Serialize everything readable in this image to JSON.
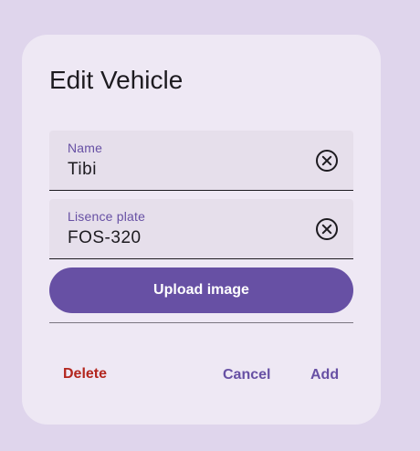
{
  "dialog": {
    "title": "Edit Vehicle",
    "fields": [
      {
        "label": "Name",
        "value": "Tibi"
      },
      {
        "label": "Lisence plate",
        "value": "FOS-320"
      }
    ],
    "upload_label": "Upload image",
    "actions": {
      "delete_label": "Delete",
      "cancel_label": "Cancel",
      "add_label": "Add"
    }
  },
  "colors": {
    "background": "#dfd5ec",
    "surface": "#eee8f4",
    "field_fill": "#e6dfeb",
    "primary": "#6750a4",
    "error": "#b3261e",
    "on_surface": "#1d1b20"
  },
  "icons": {
    "clear": "close-circle-icon"
  }
}
